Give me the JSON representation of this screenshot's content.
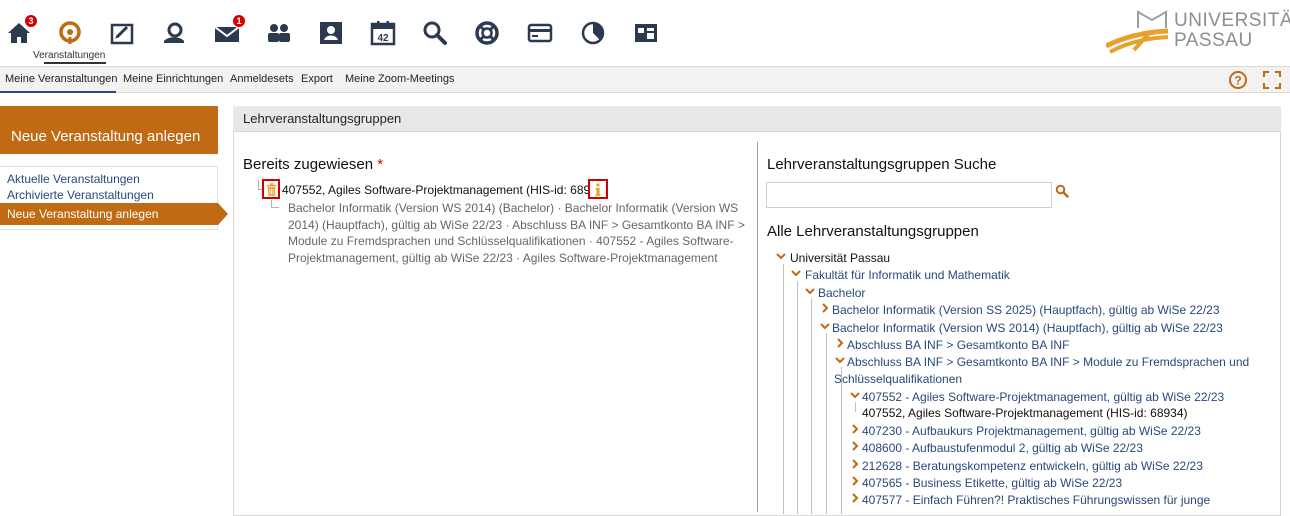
{
  "nav": {
    "home_badge": "3",
    "mail_badge": "1",
    "active_label": "Veranstaltungen",
    "calendar_day": "42"
  },
  "logo": {
    "line1": "UNIVERSITÄT",
    "line2": "PASSAU"
  },
  "subnav": {
    "items": [
      "Meine Veranstaltungen",
      "Meine Einrichtungen",
      "Anmeldesets",
      "Export",
      "Meine Zoom-Meetings"
    ],
    "active": "Meine Veranstaltungen"
  },
  "sidebar": {
    "new_button": "Neue Veranstaltung anlegen",
    "links": [
      "Aktuelle Veranstaltungen",
      "Archivierte Veranstaltungen"
    ],
    "active_link": "Neue Veranstaltung anlegen"
  },
  "main": {
    "header": "Lehrveranstaltungsgruppen",
    "assigned": {
      "title": "Bereits zugewiesen",
      "required_mark": "*",
      "item": "407552, Agiles Software-Projektmanagement (HIS-id: 68934)",
      "path": "Bachelor Informatik (Version WS 2014) (Bachelor) · Bachelor Informatik (Version WS 2014) (Hauptfach), gültig ab WiSe 22/23 · Abschluss BA INF > Gesamtkonto BA INF > Module zu Fremdsprachen und Schlüsselqualifikationen · 407552 - Agiles Software-Projektmanagement, gültig ab WiSe 22/23 · Agiles Software-Projektmanagement"
    },
    "search": {
      "title": "Lehrveranstaltungsgruppen Suche",
      "value": ""
    },
    "all": {
      "title": "Alle Lehrveranstaltungsgruppen",
      "tree": [
        "Universität Passau",
        "Fakultät für Informatik und Mathematik",
        "Bachelor",
        "Bachelor Informatik (Version SS 2025) (Hauptfach), gültig ab WiSe 22/23",
        "Bachelor Informatik (Version WS 2014) (Hauptfach), gültig ab WiSe 22/23",
        "Abschluss BA INF > Gesamtkonto BA INF",
        "Abschluss BA INF > Gesamtkonto BA INF > Module zu Fremdsprachen und",
        "Schlüsselqualifikationen",
        "407552 - Agiles Software-Projektmanagement, gültig ab WiSe 22/23",
        "407552, Agiles Software-Projektmanagement (HIS-id: 68934)",
        "407230 - Aufbaukurs Projektmanagement, gültig ab WiSe 22/23",
        "408600 - Aufbaustufenmodul 2, gültig ab WiSe 22/23",
        "212628 - Beratungskompetenz entwickeln, gültig ab WiSe 22/23",
        "407565 - Business Etikette, gültig ab WiSe 22/23",
        "407577 - Einfach Führen?! Praktisches Führungswissen für junge"
      ]
    }
  },
  "colors": {
    "accent": "#c06a13",
    "link": "#28497c",
    "icon": "#2b3a4f",
    "badge": "#d60000",
    "highlight": "#d00000"
  }
}
